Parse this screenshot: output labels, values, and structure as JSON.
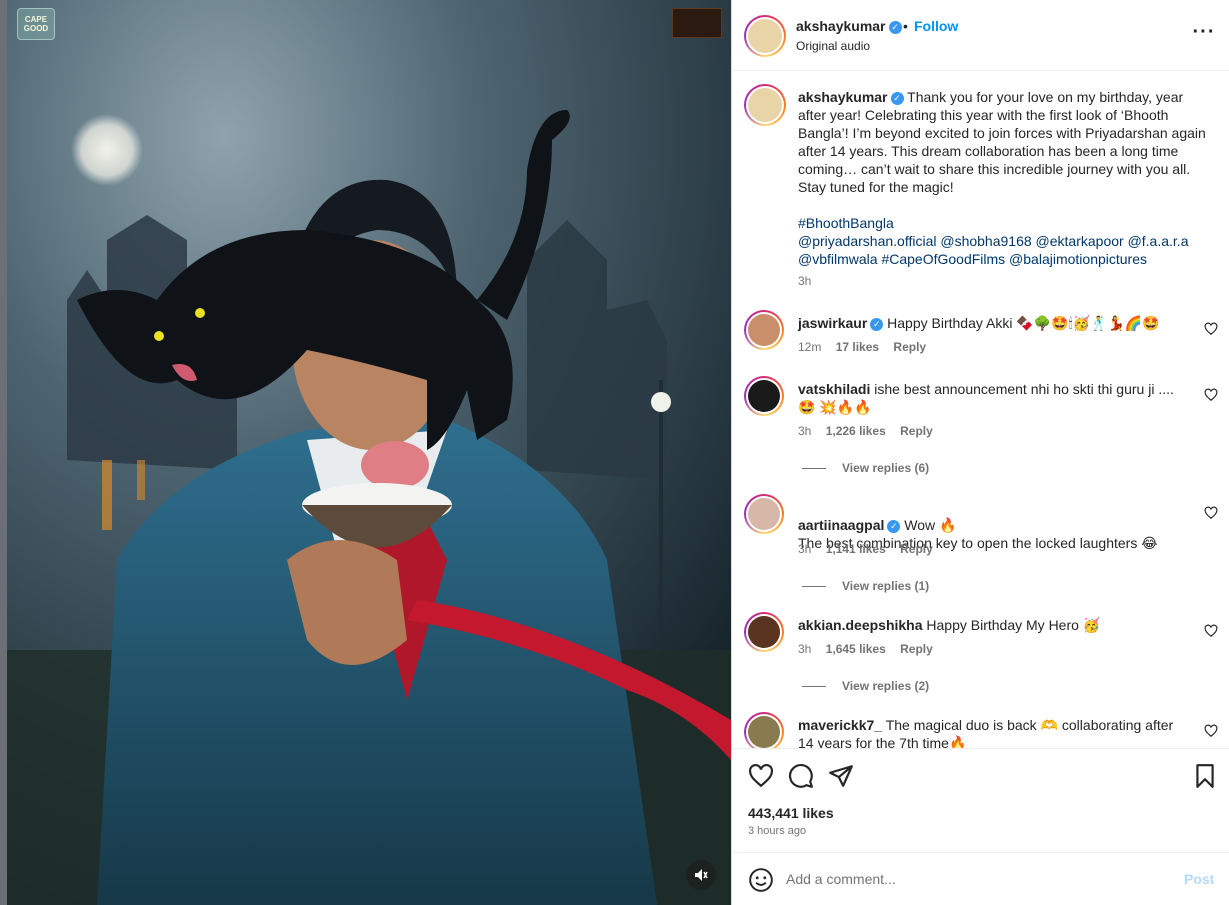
{
  "colors": {
    "accent": "#0095f6",
    "hashtag": "#00376b",
    "muted": "#737373",
    "text": "#262626"
  },
  "media": {
    "logo_left_text": "CAPE GOOD",
    "mute_icon": "speaker-muted-icon"
  },
  "post": {
    "username": "akshaykumar",
    "dot": "•",
    "follow_label": "Follow",
    "audio_label": "Original audio",
    "more_icon": "more-dots-icon",
    "caption_username": "akshaykumar",
    "caption_text": "Thank you for your love on my birthday, year after year! Celebrating this year with the first look of ‘Bhooth Bangla’! I’m beyond excited to join forces with Priyadarshan again after 14 years. This dream collaboration has been a long time coming… can’t wait to share this incredible journey with you all. Stay tuned for the magic!",
    "caption_tags": "#BhoothBangla\n@priyadarshan.official @shobha9168 @ektarkapoor @f.a.a.r.a @vbfilmwala #CapeOfGoodFilms @balajimotionpictures",
    "caption_time": "3h",
    "likes": "443,441 likes",
    "posted_ago": "3 hours ago"
  },
  "comments": [
    {
      "username": "jaswirkaur",
      "verified": true,
      "text": "Happy Birthday Akki 🍫🌳🤩🕯🥳🕺💃🌈🤩",
      "time": "12m",
      "likes": "17 likes",
      "reply": "Reply"
    },
    {
      "username": "vatskhiladi",
      "verified": false,
      "text": "ishe best announcement nhi ho skti thi guru ji ....🤩 💥🔥🔥",
      "time": "3h",
      "likes": "1,226 likes",
      "reply": "Reply",
      "view_replies": "View replies (6)"
    },
    {
      "username": "aartiinaagpal",
      "verified": true,
      "text": "Wow 🔥\nThe best combination key to open the locked laughters 😂",
      "time": "3h",
      "likes": "1,141 likes",
      "reply": "Reply",
      "view_replies": "View replies (1)"
    },
    {
      "username": "akkian.deepshikha",
      "verified": false,
      "text": "Happy Birthday My Hero 🥳",
      "time": "3h",
      "likes": "1,645 likes",
      "reply": "Reply",
      "view_replies": "View replies (2)"
    },
    {
      "username": "maverickk7_",
      "verified": false,
      "text": "The magical duo is back 🫶 collaborating after 14 years for the 7th time🔥"
    }
  ],
  "compose": {
    "placeholder": "Add a comment...",
    "post_label": "Post"
  }
}
